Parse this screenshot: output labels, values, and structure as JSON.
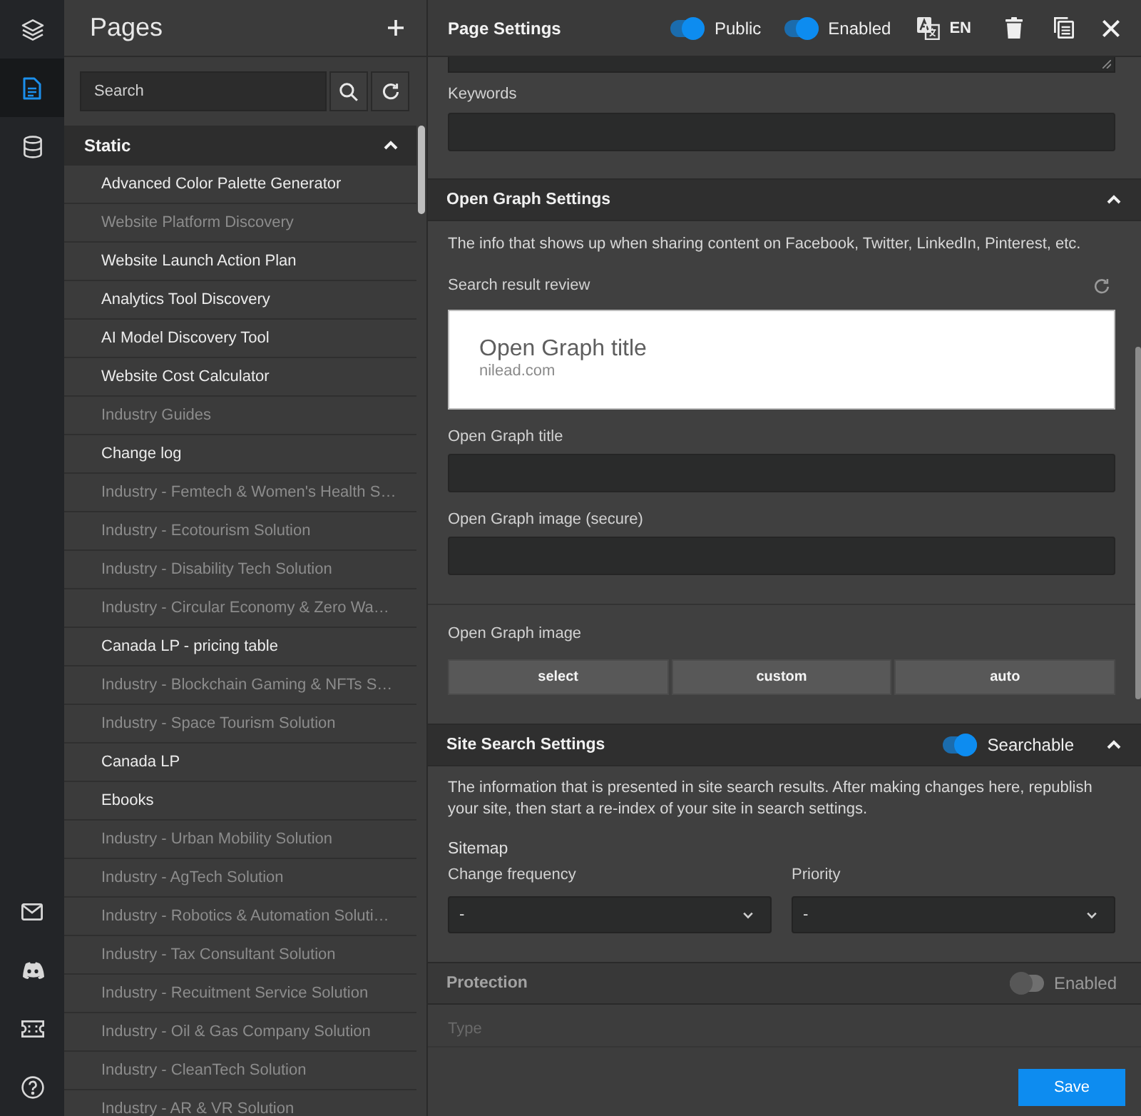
{
  "rail": {
    "items": [
      {
        "selected": false
      },
      {
        "selected": true
      },
      {
        "selected": false
      }
    ]
  },
  "pages": {
    "title": "Pages",
    "search": {
      "placeholder": "Search"
    },
    "groups": [
      {
        "label": "Static",
        "expanded": true,
        "items": [
          {
            "label": "Advanced Color Palette Generator",
            "enabled": true
          },
          {
            "label": "Website Platform Discovery",
            "enabled": false
          },
          {
            "label": "Website Launch Action Plan",
            "enabled": true
          },
          {
            "label": "Analytics Tool Discovery",
            "enabled": true
          },
          {
            "label": "AI Model Discovery Tool",
            "enabled": true
          },
          {
            "label": "Website Cost Calculator",
            "enabled": true
          },
          {
            "label": "Industry Guides",
            "enabled": false
          },
          {
            "label": "Change log",
            "enabled": true
          },
          {
            "label": "Industry - Femtech & Women's Health S…",
            "enabled": false
          },
          {
            "label": "Industry - Ecotourism Solution",
            "enabled": false
          },
          {
            "label": "Industry - Disability Tech Solution",
            "enabled": false
          },
          {
            "label": "Industry - Circular Economy & Zero Wa…",
            "enabled": false
          },
          {
            "label": "Canada LP - pricing table",
            "enabled": true
          },
          {
            "label": "Industry - Blockchain Gaming & NFTs S…",
            "enabled": false
          },
          {
            "label": "Industry - Space Tourism Solution",
            "enabled": false
          },
          {
            "label": "Canada LP",
            "enabled": true
          },
          {
            "label": "Ebooks",
            "enabled": true
          },
          {
            "label": "Industry - Urban Mobility Solution",
            "enabled": false
          },
          {
            "label": "Industry - AgTech Solution",
            "enabled": false
          },
          {
            "label": "Industry - Robotics & Automation Soluti…",
            "enabled": false
          },
          {
            "label": "Industry - Tax Consultant Solution",
            "enabled": false
          },
          {
            "label": "Industry - Recuitment Service Solution",
            "enabled": false
          },
          {
            "label": "Industry - Oil & Gas Company Solution",
            "enabled": false
          },
          {
            "label": "Industry - CleanTech Solution",
            "enabled": false
          },
          {
            "label": "Industry - AR & VR Solution",
            "enabled": false
          }
        ]
      }
    ]
  },
  "settings": {
    "title": "Page Settings",
    "toggles": [
      {
        "label": "Public",
        "on": true
      },
      {
        "label": "Enabled",
        "on": true
      }
    ],
    "language": "EN",
    "general": {
      "fields": [
        {
          "kind": "textarea"
        },
        {
          "kind": "input",
          "label": "Keywords"
        }
      ]
    },
    "open_graph": {
      "title": "Open Graph Settings",
      "expanded": true,
      "description": "The info that shows up when sharing content on Facebook, Twitter, LinkedIn, Pinterest, etc.",
      "preview": {
        "label": "Search result review",
        "title": "Open Graph title",
        "url": "nilead.com"
      },
      "fields": [
        {
          "label": "Open Graph title"
        },
        {
          "label": "Open Graph image (secure)"
        }
      ],
      "image": {
        "label": "Open Graph image",
        "options": [
          {
            "label": "select",
            "selected": false
          },
          {
            "label": "custom",
            "selected": false
          },
          {
            "label": "auto",
            "selected": false
          }
        ]
      }
    },
    "site_search": {
      "title": "Site Search Settings",
      "expanded": true,
      "toggle": {
        "label": "Searchable",
        "on": true
      },
      "description": "The information that is presented in site search results. After making changes here, republish your site, then start a re-index of your site in search settings.",
      "sitemap": {
        "label": "Sitemap",
        "selects": [
          {
            "label": "Change frequency",
            "value": "-"
          },
          {
            "label": "Priority",
            "value": "-"
          }
        ]
      }
    },
    "protection": {
      "title": "Protection",
      "toggle": {
        "label": "Enabled",
        "on": false
      },
      "fields": [
        {
          "label": "Type"
        }
      ]
    },
    "save": "Save"
  }
}
